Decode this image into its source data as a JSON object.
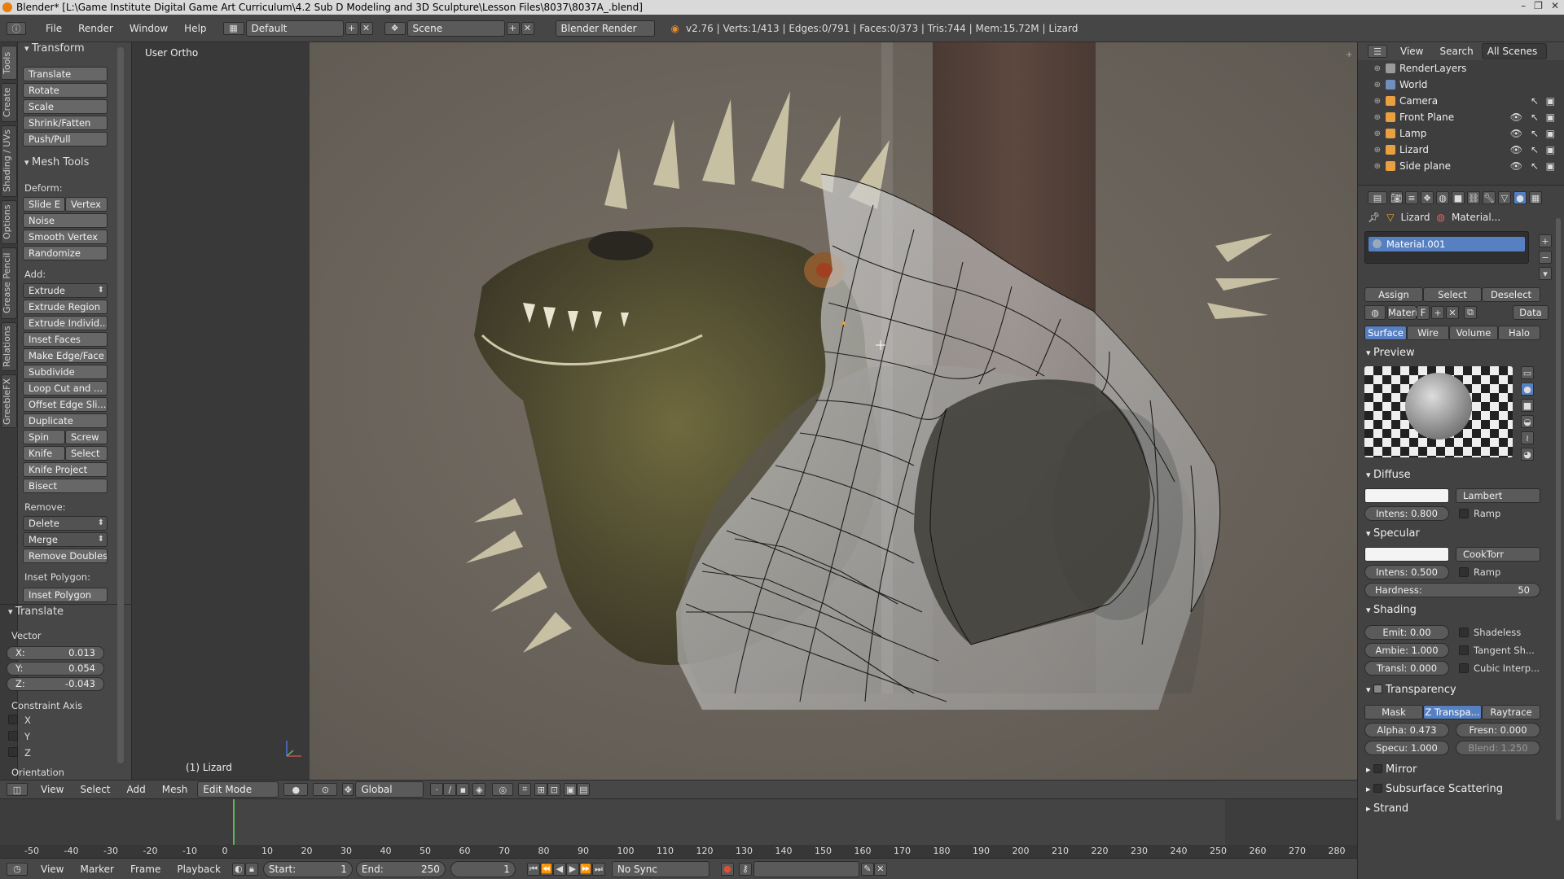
{
  "window": {
    "title": "Blender* [L:\\Game Institute Digital Game Art  Curriculum\\4.2 Sub D Modeling and 3D Sculpture\\Lesson Files\\8037\\8037A_.blend]",
    "controls": [
      "–",
      "❐",
      "✕"
    ]
  },
  "infobar": {
    "menus": [
      "File",
      "Render",
      "Window",
      "Help"
    ],
    "layout": "Default",
    "scene": "Scene",
    "engine": "Blender Render",
    "stats": "v2.76 | Verts:1/413 | Edges:0/791 | Faces:0/373 | Tris:744 | Mem:15.72M | Lizard"
  },
  "tool_tabs": [
    "Tools",
    "Create",
    "Shading / UVs",
    "Options",
    "Grease Pencil",
    "Relations",
    "GreebleFX"
  ],
  "toolshelf": {
    "transform": {
      "header": "Transform",
      "buttons": [
        "Translate",
        "Rotate",
        "Scale",
        "Shrink/Fatten",
        "Push/Pull"
      ]
    },
    "mesh_tools": {
      "header": "Mesh Tools",
      "deform_label": "Deform:",
      "slide_edge": "Slide E",
      "vertex": "Vertex",
      "noise": "Noise",
      "smooth_vertex": "Smooth Vertex",
      "randomize": "Randomize",
      "add_label": "Add:",
      "extrude": "Extrude",
      "extrude_region": "Extrude Region",
      "extrude_individual": "Extrude Individ...",
      "inset_faces": "Inset Faces",
      "make_edge_face": "Make Edge/Face",
      "subdivide": "Subdivide",
      "loop_cut": "Loop Cut and ...",
      "offset_edge": "Offset Edge Sli...",
      "duplicate": "Duplicate",
      "spin": "Spin",
      "screw": "Screw",
      "knife": "Knife",
      "select": "Select",
      "knife_project": "Knife Project",
      "bisect": "Bisect",
      "remove_label": "Remove:",
      "delete": "Delete",
      "merge": "Merge",
      "remove_doubles": "Remove Doubles",
      "inset_polygon_label": "Inset Polygon:",
      "inset_polygon": "Inset Polygon"
    },
    "operator": {
      "header": "Translate",
      "vector_label": "Vector",
      "x": {
        "label": "X:",
        "value": "0.013"
      },
      "y": {
        "label": "Y:",
        "value": "0.054"
      },
      "z": {
        "label": "Z:",
        "value": "-0.043"
      },
      "constraint_label": "Constraint Axis",
      "axes": [
        "X",
        "Y",
        "Z"
      ],
      "orientation_label": "Orientation"
    }
  },
  "viewport": {
    "view_name": "User Ortho",
    "object_label": "(1) Lizard",
    "header": {
      "menus": [
        "View",
        "Select",
        "Add",
        "Mesh"
      ],
      "mode": "Edit Mode",
      "orientation": "Global"
    }
  },
  "timeline": {
    "ruler": [
      "-50",
      "-40",
      "-30",
      "-20",
      "-10",
      "0",
      "10",
      "20",
      "30",
      "40",
      "50",
      "60",
      "70",
      "80",
      "90",
      "100",
      "110",
      "120",
      "130",
      "140",
      "150",
      "160",
      "170",
      "180",
      "190",
      "200",
      "210",
      "220",
      "230",
      "240",
      "250",
      "260",
      "270",
      "280"
    ],
    "menus": [
      "View",
      "Marker",
      "Frame",
      "Playback"
    ],
    "start": "Start:",
    "start_val": "1",
    "end": "End:",
    "end_val": "250",
    "current": "1",
    "sync": "No Sync"
  },
  "outliner": {
    "menus": [
      "View",
      "Search"
    ],
    "scenes": "All Scenes",
    "items": [
      {
        "name": "RenderLayers",
        "color": "#9a9a9a"
      },
      {
        "name": "World",
        "color": "#6f8fbf"
      },
      {
        "name": "Camera",
        "color": "#e8a040"
      },
      {
        "name": "Front Plane",
        "color": "#e8a040"
      },
      {
        "name": "Lamp",
        "color": "#e8a040"
      },
      {
        "name": "Lizard",
        "color": "#e8a040"
      },
      {
        "name": "Side plane",
        "color": "#e8a040"
      }
    ]
  },
  "properties": {
    "breadcrumb": [
      "Lizard",
      "Material..."
    ],
    "material_slot": "Material.001",
    "slot_buttons": [
      "Assign",
      "Select",
      "Deselect"
    ],
    "material_name": "Materi",
    "fake_user": "F",
    "data": "Data",
    "tabs": [
      "Surface",
      "Wire",
      "Volume",
      "Halo"
    ],
    "preview": "Preview",
    "diffuse": {
      "header": "Diffuse",
      "shader": "Lambert",
      "intensity": "Intens: 0.800",
      "ramp": "Ramp"
    },
    "specular": {
      "header": "Specular",
      "shader": "CookTorr",
      "intensity": "Intens: 0.500",
      "ramp": "Ramp",
      "hardness_label": "Hardness:",
      "hardness": "50"
    },
    "shading": {
      "header": "Shading",
      "emit": "Emit:  0.00",
      "ambient": "Ambie: 1.000",
      "translucency": "Transl: 0.000",
      "shadeless": "Shadeless",
      "tangent": "Tangent Sh...",
      "cubic": "Cubic Interp..."
    },
    "transparency": {
      "header": "Transparency",
      "modes": [
        "Mask",
        "Z Transpa...",
        "Raytrace"
      ],
      "alpha": "Alpha:  0.473",
      "fresnel": "Fresn:  0.000",
      "specular": "Specu: 1.000",
      "blend": "Blend:  1.250"
    },
    "collapsed": [
      "Mirror",
      "Subsurface Scattering",
      "Strand"
    ]
  }
}
